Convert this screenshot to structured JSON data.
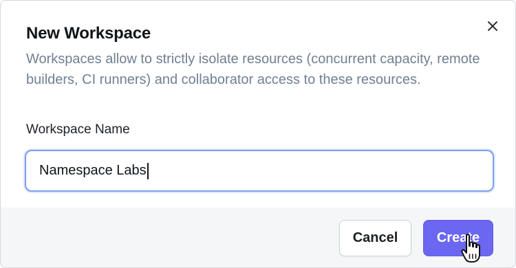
{
  "dialog": {
    "title": "New Workspace",
    "description": "Workspaces allow to strictly isolate resources (concurrent capacity, remote builders, CI runners) and collaborator access to these resources.",
    "close_icon": "close-icon",
    "field": {
      "label": "Workspace Name",
      "value": "Namespace Labs"
    },
    "buttons": {
      "cancel": "Cancel",
      "create": "Create"
    }
  },
  "colors": {
    "primary": "#6b67f0",
    "focus_ring": "#7c9ff2",
    "description_text": "#6f7f92",
    "footer_bg": "#f5f6f8"
  },
  "pointer_icon": "hand-pointer-icon"
}
